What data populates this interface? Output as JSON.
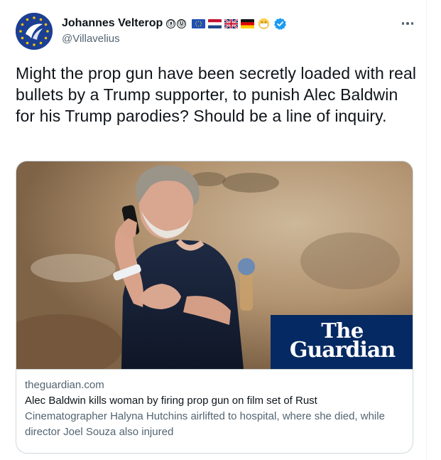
{
  "tweet": {
    "author": {
      "display_name": "Johannes Velterop",
      "handle": "@Villavelius",
      "name_badges": [
        "ⓐ",
        "Ⓤ"
      ],
      "flags": [
        "eu-flag-icon",
        "netherlands-flag-icon",
        "uk-flag-icon",
        "germany-flag-icon"
      ],
      "extra_icons": [
        "face-with-mask-icon",
        "verified-badge-icon"
      ],
      "avatar_icon": "eu-stars-logo-avatar"
    },
    "more_icon": "more-options-icon",
    "text": "Might the prop gun have been secretly loaded with real bullets by a Trump supporter, to punish Alec Baldwin for his Trump parodies? Should be a line of inquiry.",
    "card": {
      "image_alt_icon": "photo-man-on-phone",
      "publisher_logo_line1": "The",
      "publisher_logo_line2": "Guardian",
      "domain": "theguardian.com",
      "title": "Alec Baldwin kills woman by firing prop gun on film set of Rust",
      "description": "Cinematographer Halyna Hutchins airlifted to hospital, where she died, while director Joel Souza also injured"
    }
  },
  "colors": {
    "text_primary": "#0f1419",
    "text_secondary": "#536471",
    "verified_blue": "#1d9bf0",
    "guardian_navy": "#052962",
    "card_border": "#cfd9de"
  }
}
